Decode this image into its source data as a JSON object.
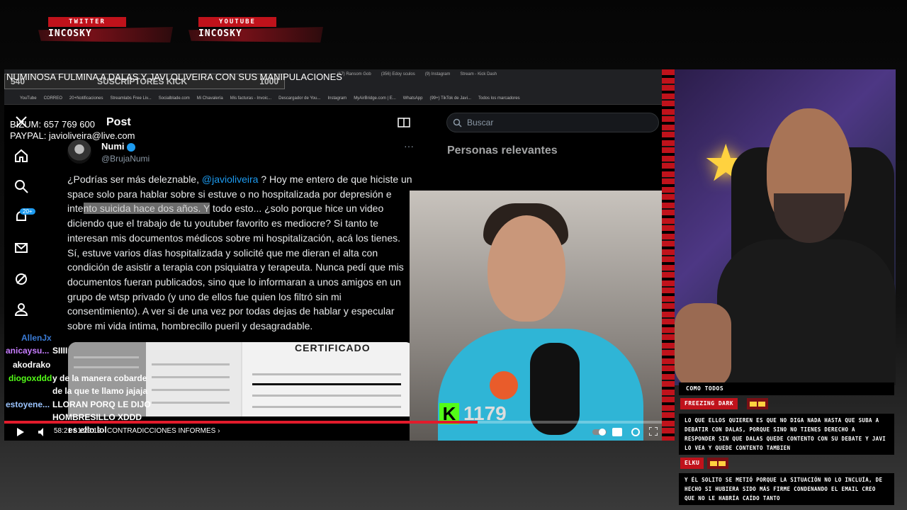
{
  "overlay": {
    "twitter_label": "TWITTER",
    "twitter_name": "INCOSKY",
    "youtube_label": "YOUTUBE",
    "youtube_name": "INCOSKY",
    "video_title": "NUMINOSA FULMINA A DALAS Y JAVI OLIVEIRA CON SUS MANIPULACIONES",
    "bizum": "BIZUM: 657 769 600",
    "paypal": "PAYPAL: javioliveira@live.com",
    "kick_count": "1179"
  },
  "browser": {
    "tabs": [
      "(17) Ransom Gob",
      "(356) Edoy sculos",
      "(9) Instagram",
      "Stream - Kick Dash"
    ],
    "bookmarks": [
      "YouTube",
      "CORREO",
      "20+Notificaciones",
      "Streamlabs Free Liv...",
      "Socialblade.com",
      "Mi Chavalería",
      "Mis facturas - Invoic...",
      "Descargador de You...",
      "Instagram",
      "MyAirBridge.com | E...",
      "WhatsApp",
      "(99+) TikTok de Javi...",
      "Todos los marcadores"
    ],
    "kick_subs_label": "SUSCRIPTORES KICK",
    "kick_subs_left": "540",
    "kick_subs_right": "1000"
  },
  "twitter": {
    "back_label": "Post",
    "author_name": "Numi",
    "author_handle": "@BrujaNumi",
    "notifications_badge": "20+",
    "search_placeholder": "Buscar",
    "relevant_title": "Personas relevantes",
    "post_text_1": "¿Podrías ser más deleznable, ",
    "post_mention": "@javioliveira",
    "post_text_2": " ? Hoy me entero de que hiciste un space solo para hablar sobre si estuve o no hospitalizada por depresión e inte",
    "post_highlight": "nto suicida hace dos años. Y",
    "post_text_3": " todo esto... ¿solo porque hice un video diciendo que el trabajo de tu youtuber favorito es mediocre? Si tanto te interesan mis documentos médicos sobre mi hospitalización, acá los tienes. Sí, estuve varios días hospitalizada y solicité que me dieran el alta con condición de asistir a terapia con psiquiatra y terapeuta. Nunca pedí que mis documentos fueran publicados, sino que lo informaran a unos amigos en un grupo de wtsp privado (y uno de ellos fue quien los filtró sin mi consentimiento). A ver si de una vez por todas dejas de hablar y especular sobre mi vida íntima, hombrecillo pueril y desagradable.",
    "cert_title": "CERTIFICADO"
  },
  "video_chat": [
    {
      "user": "AllenJx",
      "text": ""
    },
    {
      "user": "anicaysu...",
      "text": "SIIII"
    },
    {
      "user": "akodrako",
      "text": ""
    },
    {
      "user": "diogoxddd",
      "text": "y de la manera cobarde"
    },
    {
      "user": "",
      "text": "de la que te llamo jajaja"
    },
    {
      "user": "estoyene...",
      "text": "LLORAN PORQ LE DIJO"
    },
    {
      "user": "",
      "text": "HOMBRESILLO XDDD"
    },
    {
      "user": "",
      "text": "es ello lol"
    }
  ],
  "player": {
    "time": "58:21 / 1:20:19",
    "chapter": "CONTRADICCIONES INFORMES ›",
    "progress": 0.72
  },
  "chat_panel": {
    "top_line": "COMO TODOS",
    "messages": [
      {
        "user": "FREEZING DARK",
        "text": "LO QUE ELLOS QUIEREN ES QUE NO DIGA NADA HASTA QUE SUBA A DEBATIR CON DALAS, PORQUE SINO NO TIENES DERECHO A RESPONDER SIN QUE DALAS QUEDE CONTENTO CON SU DEBATE Y JAVI LO VEA Y QUEDE CONTENTO TAMBIEN"
      },
      {
        "user": "ELKU",
        "text": "Y ÉL SOLITO SE METIÓ PORQUE LA SITUACIÓN NO LO INCLUÍA, DE HECHO SI HUBIERA SIDO MÁS FIRME CONDENANDO EL EMAIL CREO QUE NO LE HABRÍA CAÍDO TANTO"
      }
    ]
  },
  "colors": {
    "accent_red": "#c0121b",
    "kick_green": "#53fc18",
    "twitter_blue": "#1d9bf0"
  }
}
